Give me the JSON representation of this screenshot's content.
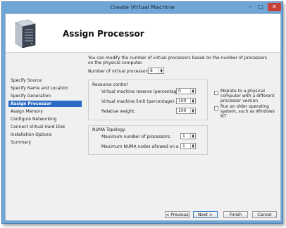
{
  "window": {
    "title": "Create Virtual Machine",
    "minimize": "–",
    "maximize": "□",
    "close": "✕"
  },
  "header": {
    "title": "Assign Processor",
    "icon": "server-icon"
  },
  "nav": {
    "items": [
      {
        "label": "Specify Source",
        "active": false
      },
      {
        "label": "Specify Name and Location",
        "active": false
      },
      {
        "label": "Specify Generation",
        "active": false
      },
      {
        "label": "Assign Processor",
        "active": true
      },
      {
        "label": "Assign Memory",
        "active": false
      },
      {
        "label": "Configure Networking",
        "active": false
      },
      {
        "label": "Connect Virtual Hard Disk",
        "active": false
      },
      {
        "label": "Installation Options",
        "active": false
      },
      {
        "label": "Summary",
        "active": false
      }
    ]
  },
  "main": {
    "intro": "You can modify the number of virtual processors based on the number of processors on the physical computer.",
    "num_processors_label": "Number of virtual processors:",
    "num_processors_value": "8",
    "resource_control": {
      "heading": "Resource control",
      "reserve_label": "Virtual machine reserve (percentage):",
      "reserve_value": "0",
      "limit_label": "Virtual machine limit (percentage):",
      "limit_value": "100",
      "weight_label": "Relative weight:",
      "weight_value": "100"
    },
    "checkboxes": {
      "migrate_label": "Migrate to a physical computer with a different processor version",
      "migrate_checked": false,
      "older_os_label": "Run an older operating system, such as Windows NT",
      "older_os_checked": false
    },
    "numa": {
      "heading": "NUMA Topology",
      "max_processors_label": "Maximum number of processors:",
      "max_processors_value": "1",
      "max_nodes_label": "Maximum NUMA nodes allowed on a socket:",
      "max_nodes_value": "1"
    }
  },
  "footer": {
    "previous": "< Previous",
    "next": "Next >",
    "finish": "Finish",
    "cancel": "Cancel"
  },
  "colors": {
    "accent": "#2b6bc6",
    "frame": "#6fa6d6",
    "close": "#c7403a"
  }
}
